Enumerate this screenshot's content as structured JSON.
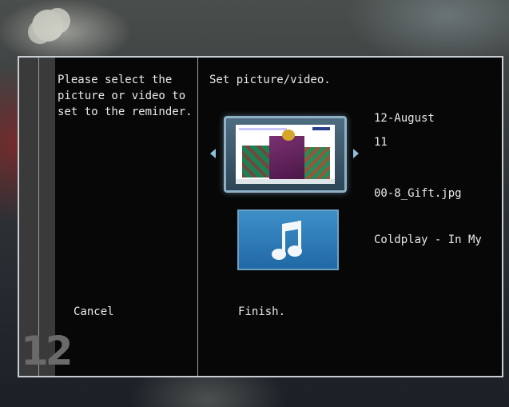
{
  "frame": {
    "day_number": "12"
  },
  "left_panel": {
    "instruction": "Please select the\npicture or video to\nset to the reminder.",
    "cancel_label": "Cancel"
  },
  "right_panel": {
    "heading": "Set picture/video.",
    "date_line1": "12-August",
    "date_line2": "11",
    "file_name": "00-8_Gift.jpg",
    "song_name": "Coldplay - In My",
    "finish_label": "Finish."
  },
  "icons": {
    "previous": "chevron-left-icon",
    "next": "chevron-right-icon",
    "music": "music-note-icon"
  },
  "colors": {
    "panel_background": "#070707",
    "frame_border": "#c8cdd2",
    "selection_border": "#8fb1c6",
    "music_tile": "#2f7dbd",
    "text": "#e9e9e9"
  }
}
